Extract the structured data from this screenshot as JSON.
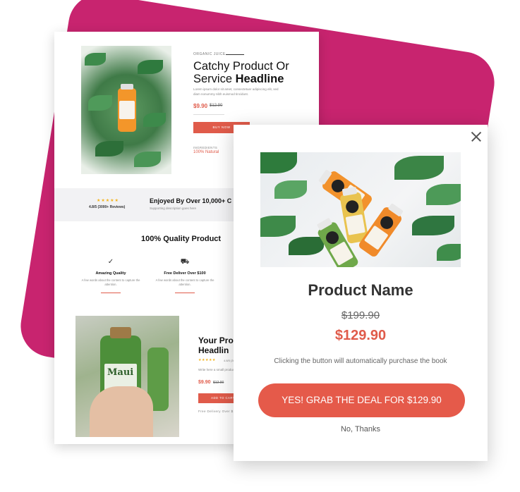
{
  "landing": {
    "eyebrow": "ORGANIC JUICE",
    "headline_line1": "Catchy Product Or",
    "headline_line2": "Service",
    "headline_bold": "Headline",
    "description": "Lorem ipsum dolor sit amet, consectetuer adipiscing elit, sed diam nonummy nibh euismod tincidunt.",
    "price": "$9.90",
    "old_price": "$12.90",
    "buy_label": "BUY NOW",
    "ingredients_label": "INGREDIENTS",
    "ingredients_value": "100% Natural",
    "stars": "★★★★★",
    "rating": "4.8/5 (3000+ Reviews)",
    "enjoyed": "Enjoyed By Over 10,000+ C",
    "enjoyed_sub": "Supporting description goes here",
    "quality_title": "100% Quality Product",
    "features": [
      {
        "icon": "check-circle-icon",
        "glyph": "✓",
        "title": "Amazing Quality",
        "text": "A few words about the content to capture the attention."
      },
      {
        "icon": "truck-icon",
        "glyph": "⛟",
        "title": "Free Deliver Over $100",
        "text": "A few words about the content to capture the attention."
      }
    ],
    "product2_title_line1": "Your Pro",
    "product2_title_line2": "Headlin",
    "product2_stars": "★★★★★",
    "product2_stars_text": "4.8/5 (3000+ Reviews)",
    "product2_write": "Write here a small product description",
    "product2_price": "$9.90",
    "product2_old_price": "$12.90",
    "add_to_cart": "ADD TO CART",
    "free_delivery": "Free Delivery Over $100"
  },
  "popup": {
    "product_name": "Product Name",
    "old_price": "$199.90",
    "price": "$129.90",
    "note": "Clicking the button will automatically purchase the book",
    "cta_label": "YES! GRAB THE DEAL FOR $129.90",
    "decline_label": "No, Thanks"
  },
  "colors": {
    "accent": "#e05b4a",
    "pink_backdrop": "#c8246f",
    "star": "#f3b21b"
  }
}
